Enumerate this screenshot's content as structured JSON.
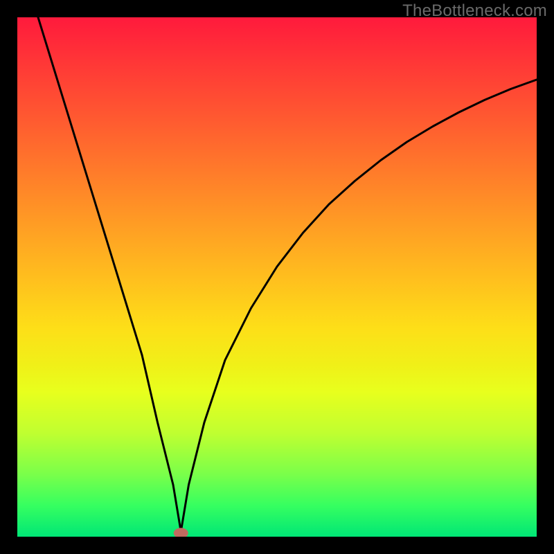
{
  "watermark": "TheBottleneck.com",
  "chart_data": {
    "type": "line",
    "title": "",
    "xlabel": "",
    "ylabel": "",
    "xlim": [
      0,
      100
    ],
    "ylim": [
      0,
      100
    ],
    "series": [
      {
        "name": "curve",
        "x": [
          4,
          8,
          12,
          16,
          20,
          24,
          27,
          30,
          31.5,
          33,
          36,
          40,
          45,
          50,
          55,
          60,
          65,
          70,
          75,
          80,
          85,
          90,
          95,
          100
        ],
        "y": [
          100,
          87,
          74,
          61,
          48,
          35,
          22,
          10,
          1,
          10,
          22,
          34,
          44,
          52,
          58.5,
          64,
          68.5,
          72.5,
          76,
          79,
          81.7,
          84.1,
          86.2,
          88
        ]
      }
    ],
    "marker": {
      "x": 31.5,
      "y": 0.7,
      "rx": 1.4,
      "ry": 1.0,
      "color": "#c06a60"
    },
    "background_gradient": {
      "type": "vertical",
      "stops": [
        {
          "pos": 0,
          "color": "#ff1a3c"
        },
        {
          "pos": 50,
          "color": "#ffbe1e"
        },
        {
          "pos": 72,
          "color": "#e8ff1d"
        },
        {
          "pos": 100,
          "color": "#00e676"
        }
      ]
    },
    "border_color": "#000000"
  }
}
